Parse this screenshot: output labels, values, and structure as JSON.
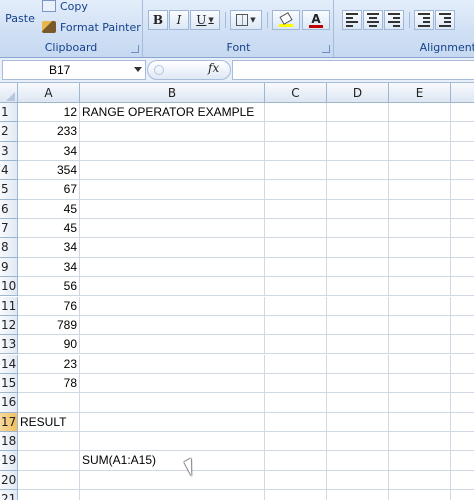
{
  "ribbon": {
    "clipboard": {
      "label": "Clipboard",
      "paste": "Paste",
      "copy": "Copy",
      "format_painter": "Format Painter"
    },
    "font": {
      "label": "Font",
      "bold": "B",
      "italic": "I",
      "underline": "U",
      "font_color_glyph": "A"
    },
    "alignment": {
      "label": "Alignment"
    }
  },
  "formula_bar": {
    "name_box": "B17",
    "fx": "fx",
    "formula": ""
  },
  "columns": [
    "A",
    "B",
    "C",
    "D",
    "E"
  ],
  "rows": [
    {
      "n": "1",
      "a": "12",
      "b": "RANGE OPERATOR EXAMPLE"
    },
    {
      "n": "2",
      "a": "233",
      "b": ""
    },
    {
      "n": "3",
      "a": "34",
      "b": ""
    },
    {
      "n": "4",
      "a": "354",
      "b": ""
    },
    {
      "n": "5",
      "a": "67",
      "b": ""
    },
    {
      "n": "6",
      "a": "45",
      "b": ""
    },
    {
      "n": "7",
      "a": "45",
      "b": ""
    },
    {
      "n": "8",
      "a": "34",
      "b": ""
    },
    {
      "n": "9",
      "a": "34",
      "b": ""
    },
    {
      "n": "10",
      "a": "56",
      "b": ""
    },
    {
      "n": "11",
      "a": "76",
      "b": ""
    },
    {
      "n": "12",
      "a": "789",
      "b": ""
    },
    {
      "n": "13",
      "a": "90",
      "b": ""
    },
    {
      "n": "14",
      "a": "23",
      "b": ""
    },
    {
      "n": "15",
      "a": "78",
      "b": ""
    },
    {
      "n": "16",
      "a": "",
      "b": ""
    },
    {
      "n": "17",
      "a": "RESULT",
      "b": ""
    },
    {
      "n": "18",
      "a": "",
      "b": ""
    },
    {
      "n": "19",
      "a": "",
      "b": "SUM(A1:A15)"
    },
    {
      "n": "20",
      "a": "",
      "b": ""
    },
    {
      "n": "21",
      "a": "",
      "b": ""
    }
  ],
  "colors": {
    "ribbon_text": "#15428b",
    "header_bg": "#dde6f2",
    "gridline": "#d0d7e5",
    "font_color_bar": "#c00000",
    "highlight_bar": "#ffff00"
  }
}
